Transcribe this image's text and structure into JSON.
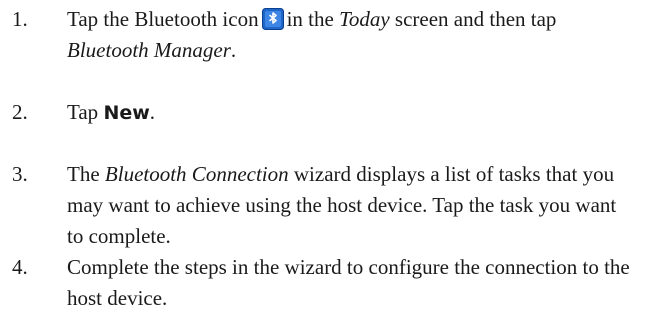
{
  "steps": [
    {
      "number": "1.",
      "part1": "Tap the Bluetooth icon",
      "icon": "bluetooth-icon",
      "part2": "in the",
      "part3": "Today",
      "part4": "screen and then tap",
      "part5": "Bluetooth Manager",
      "part6": "."
    },
    {
      "number": "2.",
      "part1": "Tap",
      "part2": "New",
      "part3": "."
    },
    {
      "number": "3.",
      "part1": "The",
      "part2": "Bluetooth Connection",
      "part3": "wizard displays a list of tasks that you may want to achieve using the host device. Tap the task you want to complete."
    },
    {
      "number": "4.",
      "text": "Complete the steps in the wizard to configure the connection to the host device."
    }
  ],
  "colors": {
    "icon_bg": "#1f66c9",
    "icon_border": "#0b3f8f",
    "icon_glyph": "#ffffff",
    "text": "#1a1a1a"
  }
}
